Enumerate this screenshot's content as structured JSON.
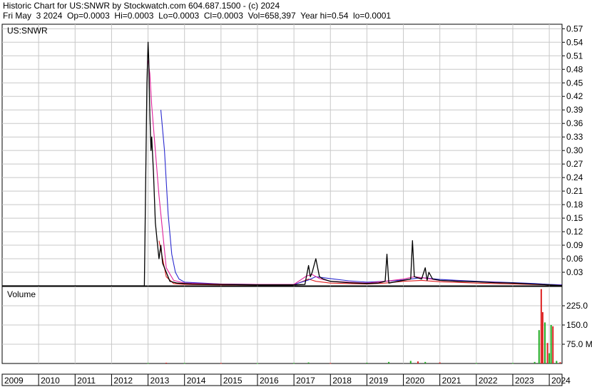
{
  "header": {
    "line1": "Historic Chart for US:SNWR by Stockwatch.com 604.687.1500 - (c) 2024",
    "line2": "Fri May  3 2024  Op=0.0003  Hi=0.0003  Lo=0.0003  Cl=0.0003  Vol=658,397  Year hi=0.54  lo=0.0001"
  },
  "chart_data": {
    "type": "line",
    "symbol_label": "US:SNWR",
    "volume_label": "Volume",
    "x_ticks": [
      "2009",
      "2010",
      "2011",
      "2012",
      "2013",
      "2014",
      "2015",
      "2016",
      "2017",
      "2018",
      "2019",
      "2020",
      "2021",
      "2022",
      "2023",
      "2024"
    ],
    "xlim": [
      2009.0,
      2024.35
    ],
    "price_ylim": [
      0,
      0.58
    ],
    "price_ticks": [
      "0.57",
      "0.54",
      "0.51",
      "0.48",
      "0.45",
      "0.42",
      "0.39",
      "0.36",
      "0.33",
      "0.30",
      "0.27",
      "0.24",
      "0.21",
      "0.18",
      "0.15",
      "0.12",
      "0.09",
      "0.06",
      "0.03"
    ],
    "volume_ylim": [
      0,
      300
    ],
    "volume_ticks": [
      "225.0",
      "150.0",
      "75.0 M"
    ],
    "grid": true,
    "colors": {
      "price": "#000000",
      "ma_short": "#e0209a",
      "ma_long": "#2a2ad0",
      "ma_mid": "#e02020",
      "volume_up": "#22aa22",
      "volume_down": "#dd2222",
      "grid": "#c8c8c8"
    },
    "series": [
      {
        "key": "price",
        "x": [
          2009.0,
          2012.9,
          2012.97,
          2013.0,
          2013.02,
          2013.05,
          2013.08,
          2013.1,
          2013.15,
          2013.2,
          2013.25,
          2013.3,
          2013.35,
          2013.4,
          2013.5,
          2013.6,
          2013.8,
          2014.2,
          2015.0,
          2016.0,
          2017.0,
          2017.3,
          2017.4,
          2017.45,
          2017.5,
          2017.6,
          2017.7,
          2017.8,
          2018.0,
          2018.5,
          2019.0,
          2019.3,
          2019.5,
          2019.55,
          2019.6,
          2020.0,
          2020.2,
          2020.25,
          2020.3,
          2020.5,
          2020.6,
          2020.65,
          2020.7,
          2020.8,
          2021.0,
          2021.5,
          2022.0,
          2022.5,
          2023.0,
          2023.5,
          2024.0,
          2024.34
        ],
        "y": [
          0,
          0,
          0.45,
          0.54,
          0.5,
          0.38,
          0.3,
          0.33,
          0.25,
          0.14,
          0.1,
          0.06,
          0.09,
          0.05,
          0.03,
          0.01,
          0.006,
          0.004,
          0.003,
          0.002,
          0.002,
          0.003,
          0.045,
          0.02,
          0.03,
          0.06,
          0.02,
          0.015,
          0.01,
          0.007,
          0.005,
          0.006,
          0.01,
          0.07,
          0.006,
          0.012,
          0.015,
          0.1,
          0.02,
          0.015,
          0.04,
          0.012,
          0.03,
          0.015,
          0.012,
          0.01,
          0.009,
          0.007,
          0.006,
          0.004,
          0.002,
          0.0003
        ]
      },
      {
        "key": "ma_short",
        "x": [
          2013.0,
          2013.05,
          2013.1,
          2013.2,
          2013.3,
          2013.4,
          2013.5,
          2013.7,
          2014.0,
          2015.0,
          2016.0,
          2017.0,
          2017.35,
          2017.5,
          2017.7,
          2018.0,
          2019.0,
          2019.5,
          2020.0,
          2020.3,
          2020.5,
          2021.0,
          2022.0,
          2023.0,
          2024.0,
          2024.34
        ],
        "y": [
          0.5,
          0.47,
          0.4,
          0.3,
          0.2,
          0.12,
          0.04,
          0.012,
          0.006,
          0.004,
          0.003,
          0.003,
          0.022,
          0.025,
          0.016,
          0.01,
          0.006,
          0.01,
          0.015,
          0.02,
          0.018,
          0.012,
          0.009,
          0.006,
          0.002,
          0.001
        ]
      },
      {
        "key": "ma_long",
        "x": [
          2013.35,
          2013.45,
          2013.55,
          2013.65,
          2013.75,
          2013.85,
          2014.0,
          2014.5,
          2015.0,
          2016.0,
          2017.0,
          2017.4,
          2017.6,
          2018.0,
          2018.5,
          2019.0,
          2019.5,
          2020.0,
          2020.5,
          2021.0,
          2022.0,
          2023.0,
          2023.6,
          2024.0,
          2024.34
        ],
        "y": [
          0.39,
          0.3,
          0.16,
          0.07,
          0.03,
          0.015,
          0.008,
          0.006,
          0.004,
          0.003,
          0.003,
          0.013,
          0.02,
          0.016,
          0.011,
          0.008,
          0.01,
          0.013,
          0.018,
          0.014,
          0.01,
          0.007,
          0.005,
          0.003,
          0.002
        ]
      },
      {
        "key": "ma_mid",
        "x": [
          2013.3,
          2013.5,
          2013.7,
          2014.0,
          2015.0,
          2016.0,
          2017.0,
          2017.4,
          2017.6,
          2018.0,
          2019.0,
          2019.5,
          2020.0,
          2020.5,
          2021.0,
          2022.0,
          2023.0,
          2024.0,
          2024.34
        ],
        "y": [
          0.1,
          0.02,
          0.005,
          0.003,
          0.002,
          0.002,
          0.002,
          0.015,
          0.01,
          0.006,
          0.004,
          0.006,
          0.01,
          0.012,
          0.009,
          0.006,
          0.004,
          0.002,
          0.001
        ]
      }
    ],
    "volume": {
      "x": [
        2013.0,
        2013.5,
        2014.0,
        2015.0,
        2016.0,
        2017.0,
        2017.4,
        2018.0,
        2019.0,
        2019.6,
        2020.2,
        2020.4,
        2020.6,
        2021.0,
        2022.0,
        2023.0,
        2023.6,
        2023.72,
        2023.78,
        2023.82,
        2023.88,
        2023.95,
        2024.0,
        2024.05,
        2024.1,
        2024.2,
        2024.3
      ],
      "y": [
        2,
        3,
        2,
        2,
        1,
        2,
        4,
        2,
        3,
        6,
        10,
        8,
        6,
        4,
        2,
        2,
        6,
        130,
        290,
        200,
        160,
        80,
        40,
        150,
        145,
        10,
        5
      ],
      "up": [
        true,
        false,
        true,
        false,
        true,
        true,
        true,
        false,
        true,
        true,
        true,
        false,
        true,
        false,
        true,
        true,
        true,
        true,
        false,
        false,
        true,
        false,
        true,
        true,
        false,
        true,
        false
      ]
    }
  }
}
